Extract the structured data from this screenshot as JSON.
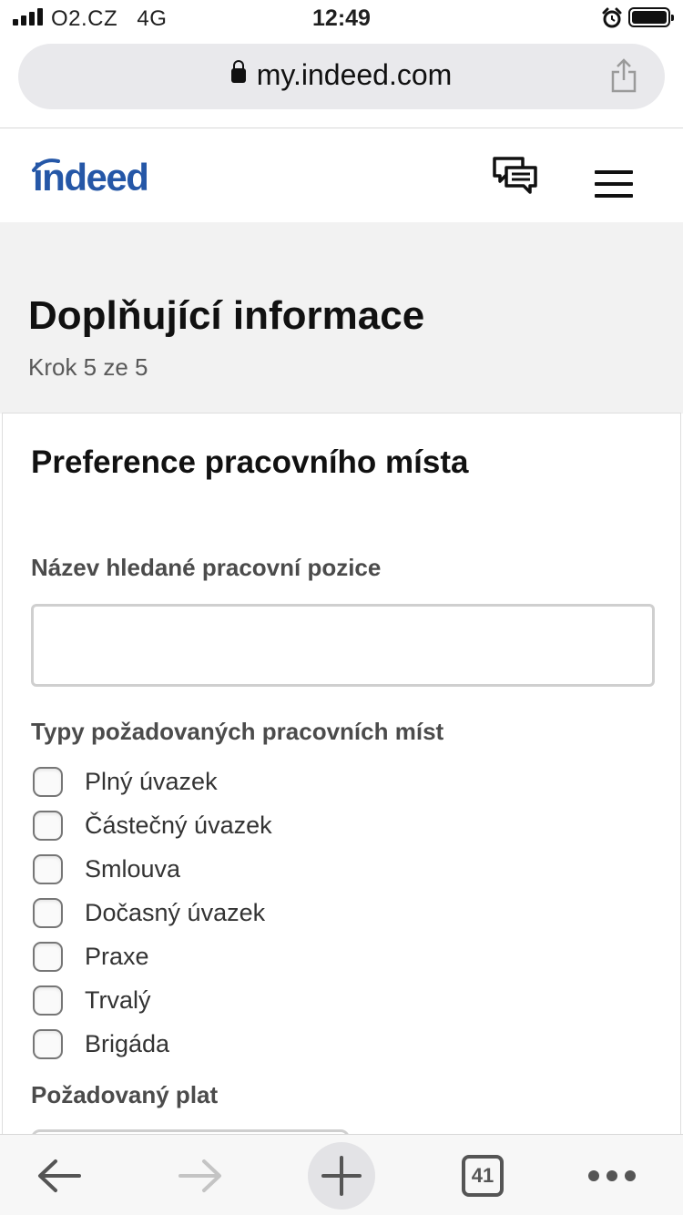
{
  "status_bar": {
    "carrier": "O2.CZ",
    "network": "4G",
    "time": "12:49"
  },
  "browser": {
    "url": "my.indeed.com"
  },
  "header": {
    "logo_text": "indeed",
    "icons": [
      "messages-icon",
      "menu-icon"
    ]
  },
  "page": {
    "title": "Doplňující informace",
    "step": "Krok 5 ze 5"
  },
  "form": {
    "section_title": "Preference pracovního místa",
    "job_title_label": "Název hledané pracovní pozice",
    "job_title_value": "",
    "job_types_label": "Typy požadovaných pracovních míst",
    "job_types": [
      {
        "label": "Plný úvazek",
        "checked": false
      },
      {
        "label": "Částečný úvazek",
        "checked": false
      },
      {
        "label": "Smlouva",
        "checked": false
      },
      {
        "label": "Dočasný úvazek",
        "checked": false
      },
      {
        "label": "Praxe",
        "checked": false
      },
      {
        "label": "Trvalý",
        "checked": false
      },
      {
        "label": "Brigáda",
        "checked": false
      }
    ],
    "salary_label": "Požadovaný plat"
  },
  "toolbar": {
    "tab_count": "41",
    "icons": [
      "back-arrow-icon",
      "forward-arrow-icon",
      "plus-icon",
      "tabs-icon",
      "more-icon"
    ]
  },
  "colors": {
    "brand": "#2557a7",
    "band_background": "#f2f2f2",
    "url_bar_background": "#e9e9ec"
  }
}
